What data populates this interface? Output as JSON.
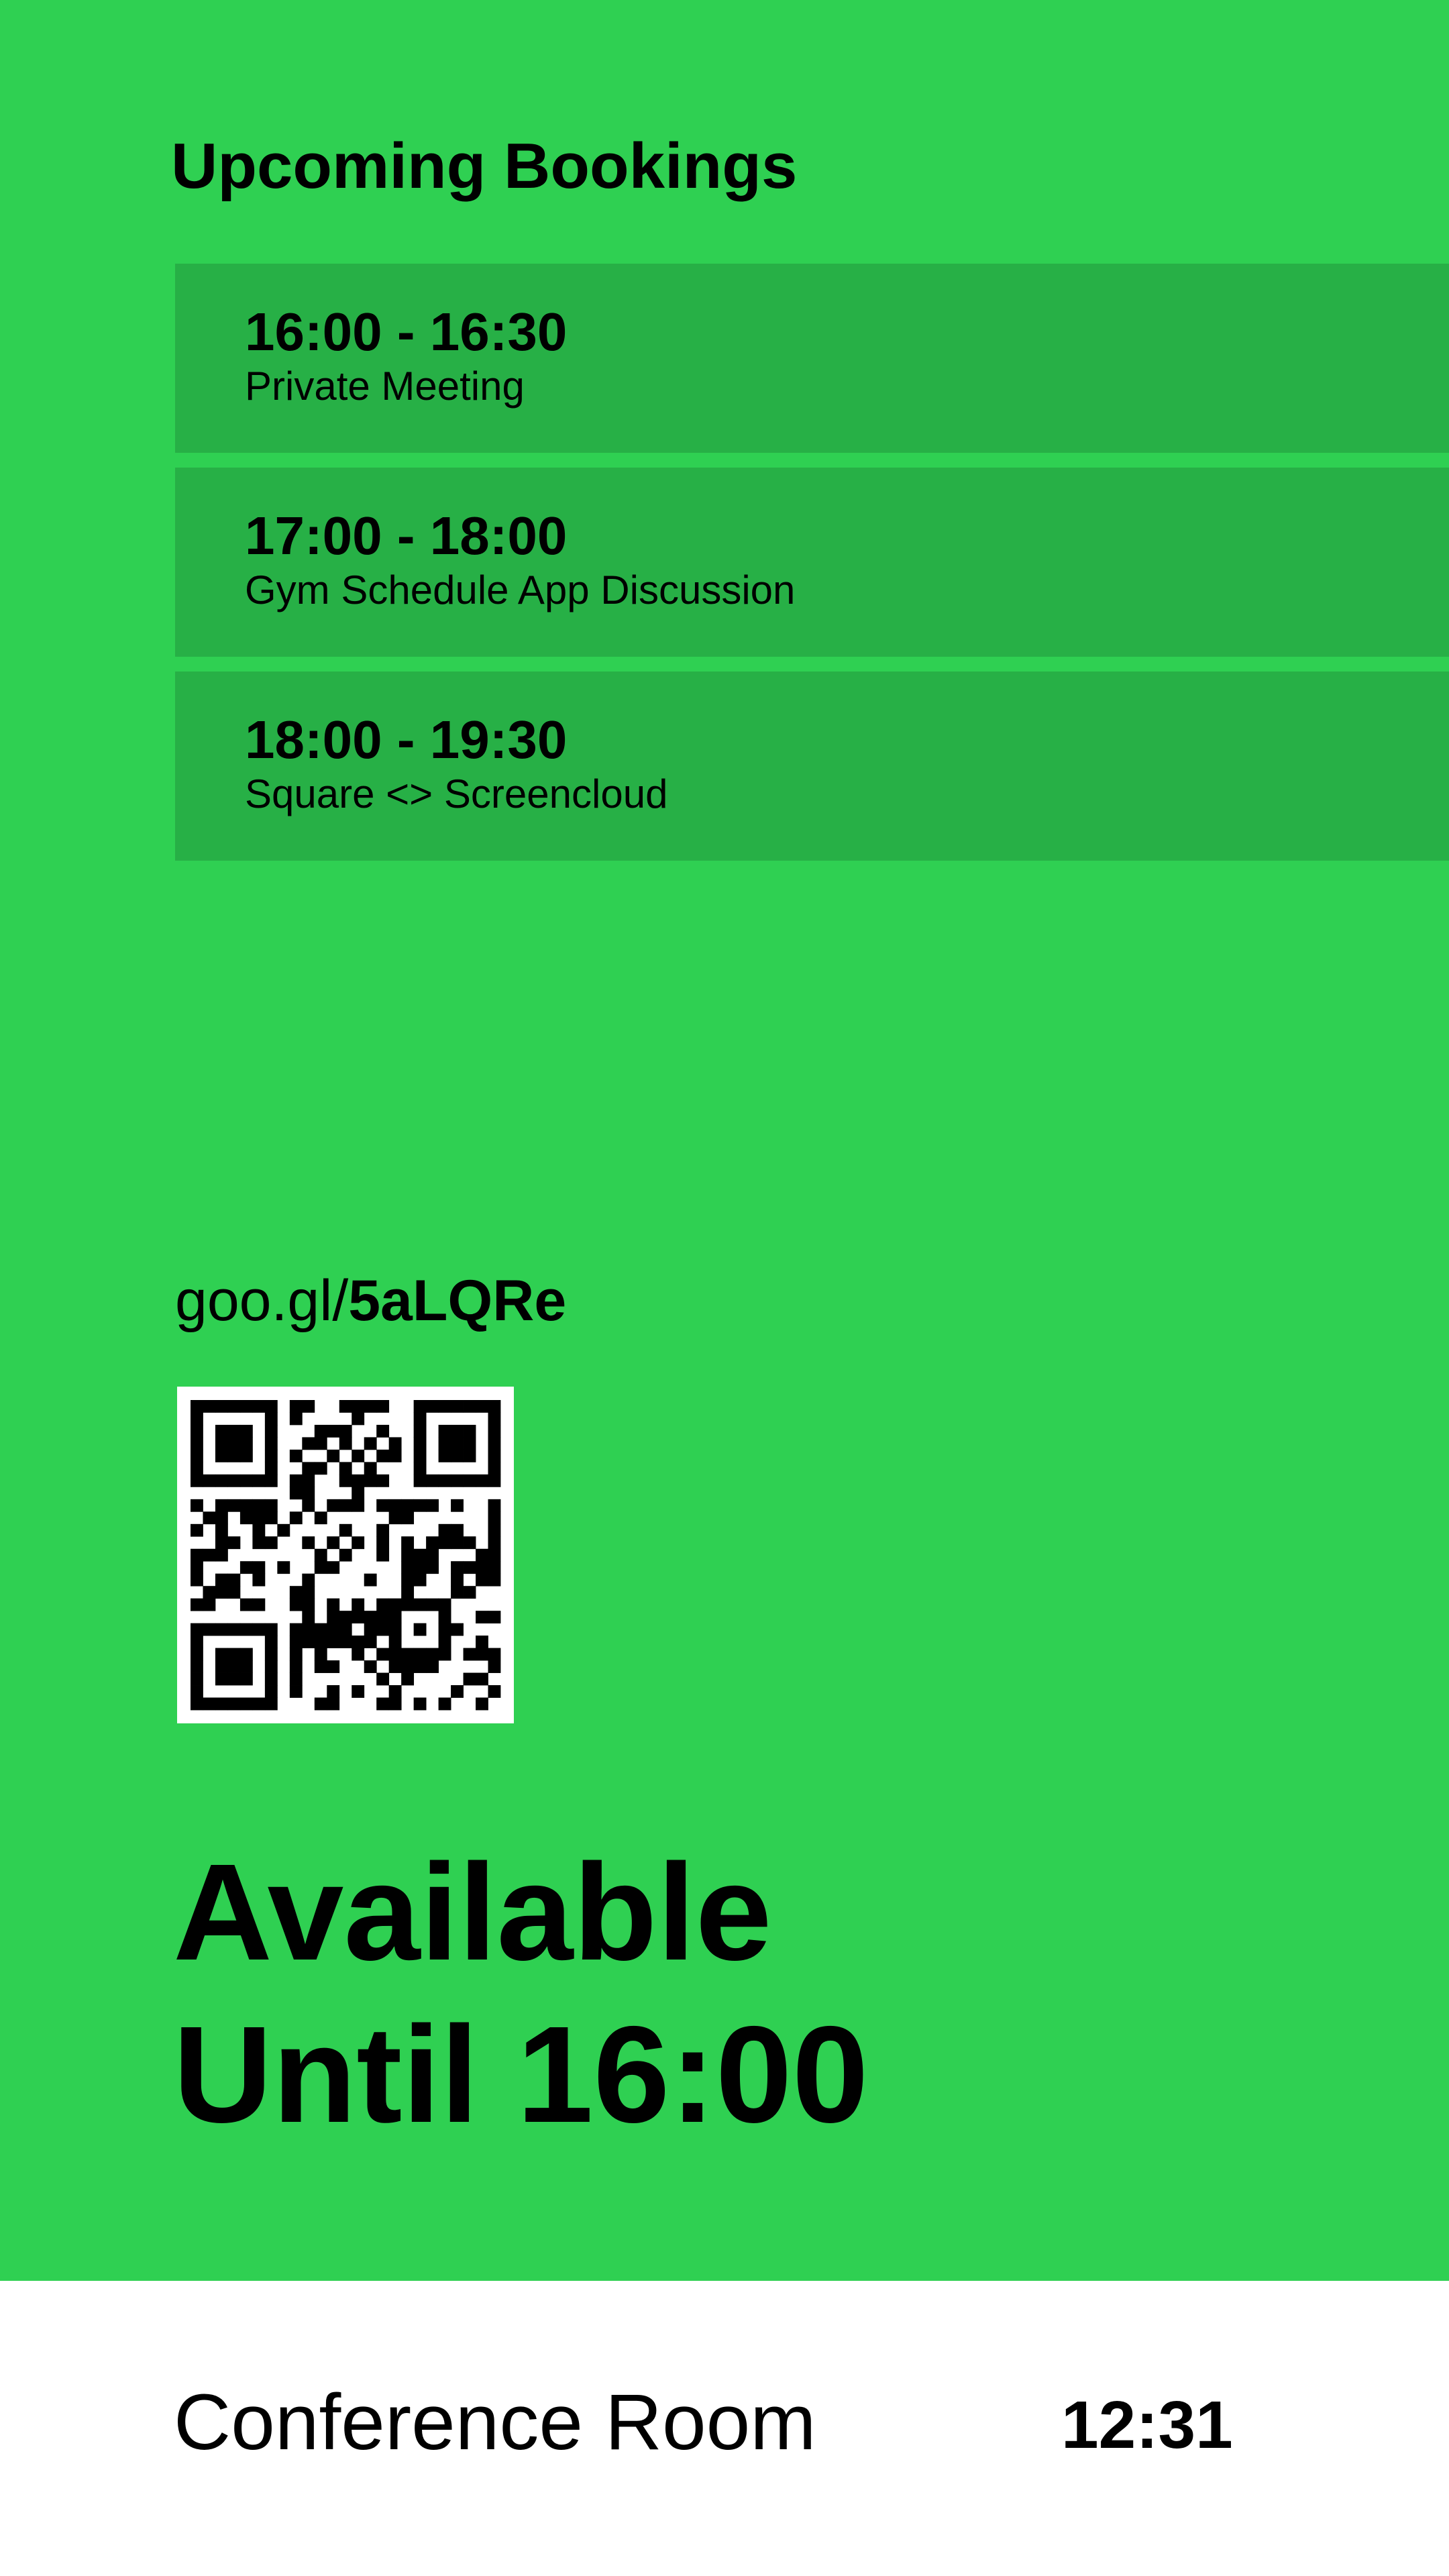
{
  "bookings_panel": {
    "heading": "Upcoming Bookings",
    "items": [
      {
        "time": "16:00 - 16:30",
        "title": "Private Meeting"
      },
      {
        "time": "17:00 - 18:00",
        "title": "Gym Schedule App Discussion"
      },
      {
        "time": "18:00 - 19:30",
        "title": "Square <> Screencloud"
      }
    ]
  },
  "booking_link": {
    "domain": "goo.gl/",
    "code": "5aLQRe",
    "qr_icon": "qr-code-icon"
  },
  "status": {
    "line1": "Available",
    "line2": "Until 16:00"
  },
  "footer": {
    "room_name": "Conference Room",
    "time": "12:31"
  },
  "colors": {
    "available_background": "#2fd052",
    "booking_card": "#27b046",
    "footer_background": "#ffffff",
    "text": "#000000"
  }
}
